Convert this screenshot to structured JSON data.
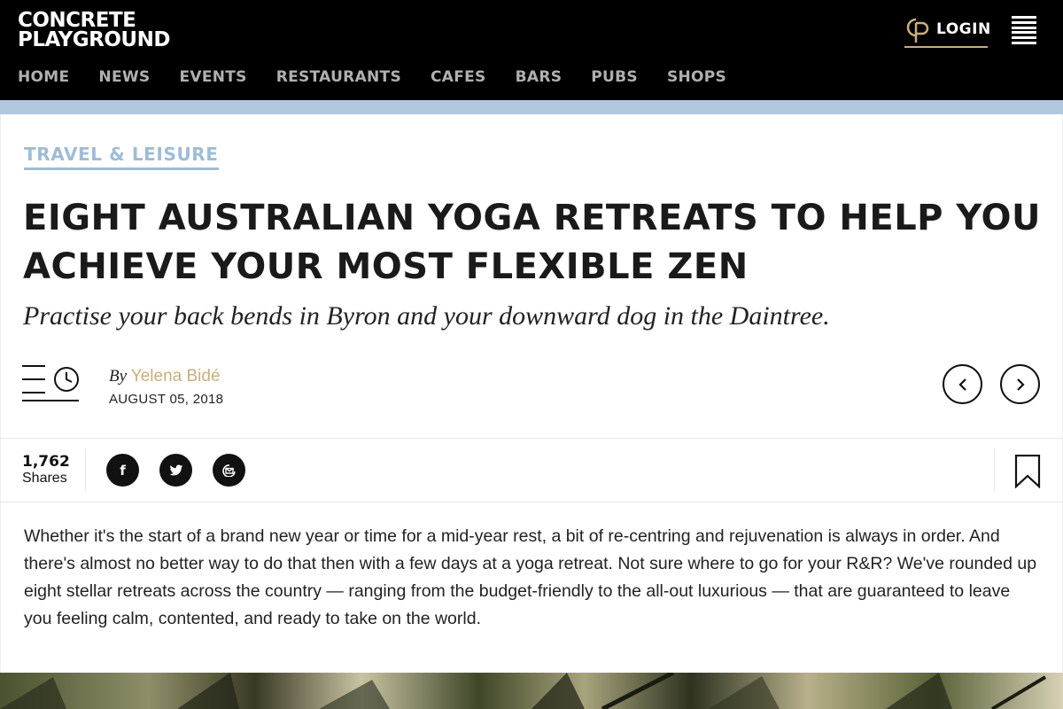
{
  "header": {
    "logo_line1": "CONCRETE",
    "logo_line2": "PLAYGROUND",
    "login_label": "LOGIN",
    "login_icon": "cp-monogram-icon",
    "menu_icon": "hamburger-menu-icon"
  },
  "nav": {
    "items": [
      "HOME",
      "NEWS",
      "EVENTS",
      "RESTAURANTS",
      "CAFES",
      "BARS",
      "PUBS",
      "SHOPS"
    ]
  },
  "article": {
    "category": "TRAVEL & LEISURE",
    "title": "EIGHT AUSTRALIAN YOGA RETREATS TO HELP YOU ACHIEVE YOUR MOST FLEXIBLE ZEN",
    "subtitle": "Practise your back bends in Byron and your downward dog in the Daintree.",
    "byline_prefix": "By",
    "author": "Yelena Bidé",
    "date": "AUGUST 05, 2018",
    "intro": "Whether it's the start of a brand new year or time for a mid-year rest, a bit of re-centring and rejuvenation is always in order. And there's almost no better way to do that then with a few days at a yoga retreat. Not sure where to go for your R&R? We've rounded up eight stellar retreats across the country — ranging from the budget-friendly to the all-out luxurious — that are guaranteed to leave you feeling calm, contented, and ready to take on the world."
  },
  "share": {
    "count": "1,762",
    "label": "Shares",
    "facebook_glyph": "f",
    "icons": [
      "facebook-icon",
      "twitter-icon",
      "email-icon",
      "bookmark-icon"
    ]
  },
  "colors": {
    "header_bg": "#000000",
    "accent_blue": "#9fbcd6",
    "accent_gold": "#c9ae7c",
    "text": "#222222"
  }
}
